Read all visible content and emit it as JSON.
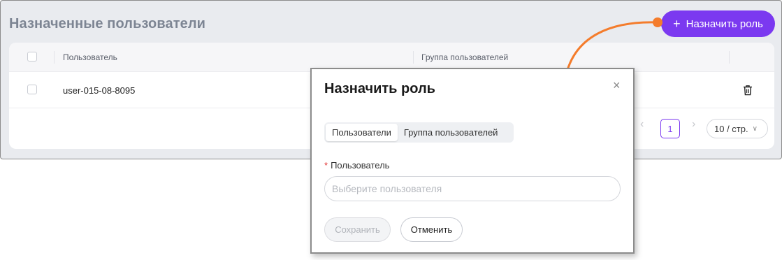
{
  "section": {
    "title": "Назначенные пользователи"
  },
  "toolbar": {
    "assign_plus": "+",
    "assign_label": "Назначить роль"
  },
  "table": {
    "headers": {
      "user": "Пользователь",
      "group": "Группа пользователей"
    },
    "rows": [
      {
        "user": "user-015-08-8095"
      }
    ]
  },
  "pagination": {
    "prev": "‹",
    "current": "1",
    "next": "›",
    "page_size": "10 / стр.",
    "page_size_chevron": "∨"
  },
  "modal": {
    "title": "Назначить роль",
    "close": "×",
    "tabs": [
      {
        "label": "Пользователи",
        "active": true
      },
      {
        "label": "Группа пользователей",
        "active": false
      }
    ],
    "field": {
      "required_mark": "*",
      "label": "Пользователь",
      "placeholder": "Выберите пользователя"
    },
    "save_label": "Сохранить",
    "cancel_label": "Отменить"
  },
  "colors": {
    "accent": "#7b39f0",
    "annotation_arrow": "#f47c2c"
  },
  "icons": {
    "trash": "trash-icon",
    "close": "close-icon",
    "plus": "plus-icon",
    "chevron_down": "chevron-down-icon"
  }
}
